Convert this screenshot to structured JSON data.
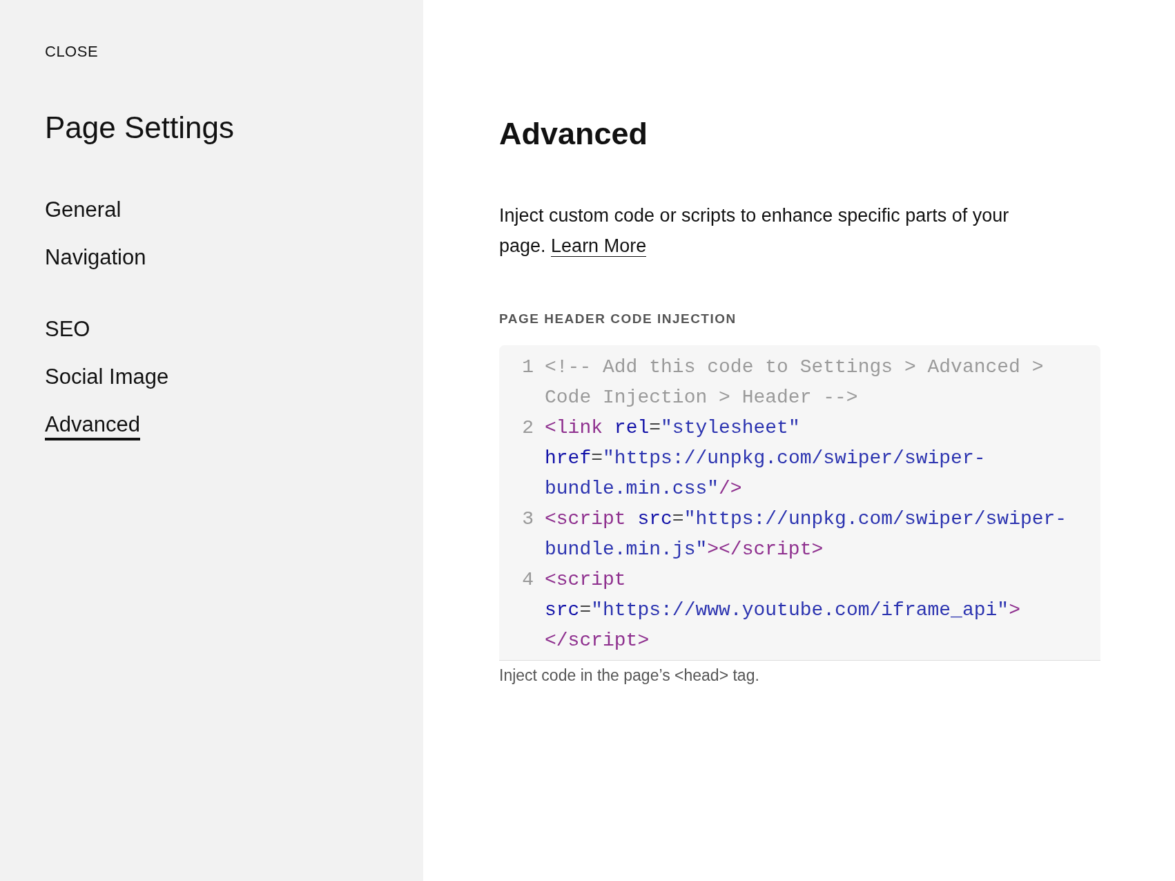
{
  "close_link": "CLOSE",
  "sidebar": {
    "title": "Page Settings",
    "groups": [
      [
        {
          "label": "General",
          "selected": false
        },
        {
          "label": "Navigation",
          "selected": false
        }
      ],
      [
        {
          "label": "SEO",
          "selected": false
        },
        {
          "label": "Social Image",
          "selected": false
        },
        {
          "label": "Advanced",
          "selected": true
        }
      ]
    ]
  },
  "content": {
    "title": "Advanced",
    "description": "Inject custom code or scripts to enhance specific parts of your page.",
    "learn_more_link": "Learn More",
    "field": {
      "label": "PAGE HEADER CODE INJECTION",
      "lines": [
        {
          "number": "1",
          "words": [
            [
              {
                "text": "<!-- Add this code to Settings > Advanced > Code Injection > Header -->",
                "kind": "comment"
              }
            ]
          ]
        },
        {
          "number": "2",
          "words": [
            [
              {
                "text": "<link",
                "kind": "tag"
              }
            ],
            [
              {
                "text": "rel",
                "kind": "attr"
              },
              {
                "text": "=",
                "kind": "punct"
              },
              {
                "text": "\"stylesheet\"",
                "kind": "string"
              }
            ],
            [
              {
                "text": "href",
                "kind": "attr"
              },
              {
                "text": "=",
                "kind": "punct"
              },
              {
                "text": "\"https://unpkg.com/swiper/swiper-bundle.min.css\"",
                "kind": "string"
              },
              {
                "text": "/>",
                "kind": "tag"
              }
            ]
          ]
        },
        {
          "number": "3",
          "words": [
            [
              {
                "text": "<script",
                "kind": "tag"
              }
            ],
            [
              {
                "text": "src",
                "kind": "attr"
              },
              {
                "text": "=",
                "kind": "punct"
              },
              {
                "text": "\"https://unpkg.com/swiper/swiper-bundle.min.js\"",
                "kind": "string"
              },
              {
                "text": "></script>",
                "kind": "tag"
              }
            ]
          ]
        },
        {
          "number": "4",
          "words": [
            [
              {
                "text": "<script",
                "kind": "tag"
              }
            ],
            [
              {
                "text": "src",
                "kind": "attr"
              },
              {
                "text": "=",
                "kind": "punct"
              },
              {
                "text": "\"https://www.youtube.com/iframe_api\"",
                "kind": "string"
              },
              {
                "text": ">",
                "kind": "tag"
              }
            ],
            [
              {
                "text": "</script>",
                "kind": "tag"
              }
            ]
          ]
        }
      ],
      "help": "Inject code in the page’s <head> tag."
    }
  }
}
